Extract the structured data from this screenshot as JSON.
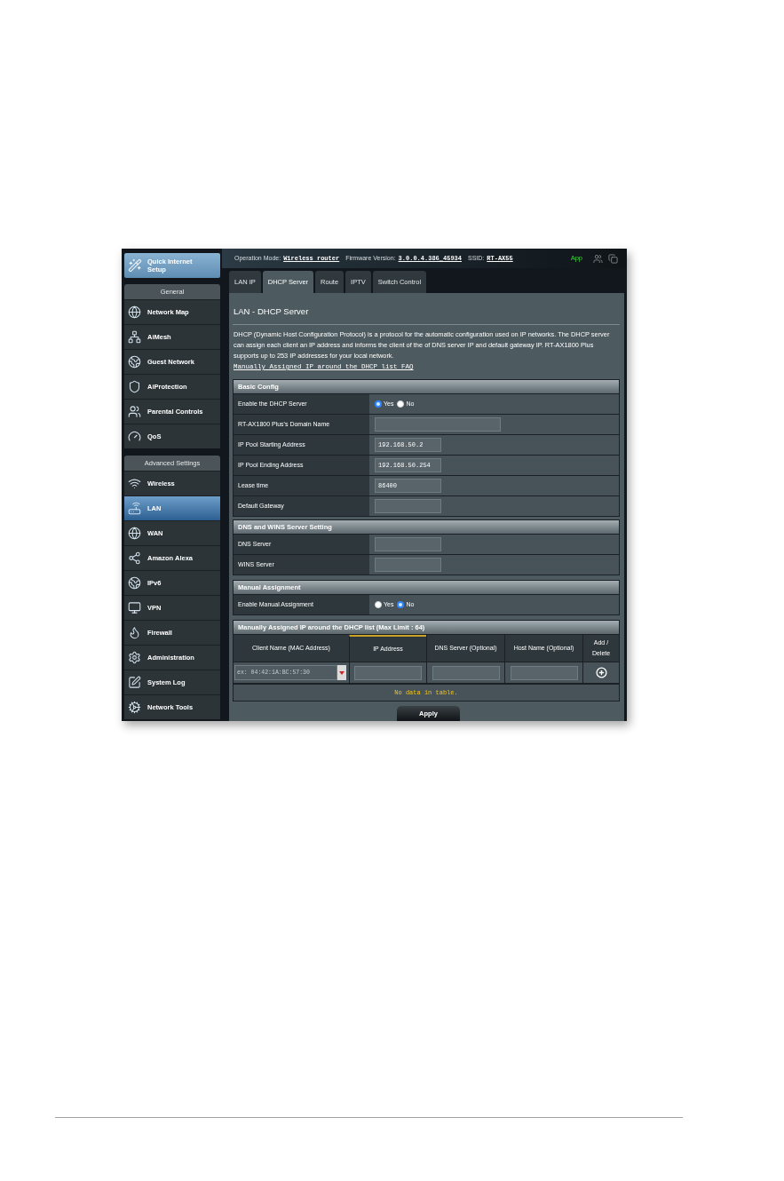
{
  "top_bar": {
    "items": [
      {
        "kind": "label",
        "text": "Operation Mode:"
      },
      {
        "kind": "link",
        "text": "Wireless router"
      },
      {
        "kind": "label",
        "text": "Firmware Version:"
      },
      {
        "kind": "link",
        "text": "3.0.0.4.386_45934"
      },
      {
        "kind": "label",
        "text": "SSID:"
      },
      {
        "kind": "link",
        "text": "RT-AX55"
      }
    ],
    "app": "App"
  },
  "sidebar": {
    "quick_setup": "Quick Internet Setup",
    "sections": [
      {
        "title": "General",
        "items": [
          {
            "label": "Network Map",
            "selected": false
          },
          {
            "label": "AiMesh",
            "selected": false
          },
          {
            "label": "Guest Network",
            "selected": false
          },
          {
            "label": "AiProtection",
            "selected": false
          },
          {
            "label": "Parental Controls",
            "selected": false
          },
          {
            "label": "QoS",
            "selected": false
          }
        ]
      },
      {
        "title": "Advanced Settings",
        "items": [
          {
            "label": "Wireless",
            "selected": false
          },
          {
            "label": "LAN",
            "selected": true
          },
          {
            "label": "WAN",
            "selected": false
          },
          {
            "label": "Amazon Alexa",
            "selected": false
          },
          {
            "label": "IPv6",
            "selected": false
          },
          {
            "label": "VPN",
            "selected": false
          },
          {
            "label": "Firewall",
            "selected": false
          },
          {
            "label": "Administration",
            "selected": false
          },
          {
            "label": "System Log",
            "selected": false
          },
          {
            "label": "Network Tools",
            "selected": false
          }
        ]
      }
    ]
  },
  "tabs": [
    {
      "label": "LAN IP",
      "selected": false
    },
    {
      "label": "DHCP Server",
      "selected": true
    },
    {
      "label": "Route",
      "selected": false
    },
    {
      "label": "IPTV",
      "selected": false
    },
    {
      "label": "Switch Control",
      "selected": false
    }
  ],
  "page": {
    "title": "LAN - DHCP Server",
    "description": "DHCP (Dynamic Host Configuration Protocol) is a protocol for the automatic configuration used on IP networks. The DHCP server can assign each client an IP address and informs the client of the of DNS server IP and default gateway IP. RT-AX1800 Plus supports up to 253 IP addresses for your local network.",
    "faq_link": "Manually Assigned IP around the DHCP list FAQ"
  },
  "sections": [
    {
      "title": "Basic Config",
      "rows": [
        {
          "kind": "radio",
          "label": "Enable the DHCP Server",
          "options": [
            {
              "label": "Yes",
              "selected": true
            },
            {
              "label": "No",
              "selected": false
            }
          ]
        },
        {
          "kind": "wide_input",
          "label": "RT-AX1800 Plus's Domain Name"
        },
        {
          "kind": "input",
          "label": "IP Pool Starting Address",
          "value": "192.168.50.2"
        },
        {
          "kind": "input",
          "label": "IP Pool Ending Address",
          "value": "192.168.50.254"
        },
        {
          "kind": "input",
          "label": "Lease time",
          "value": "86400"
        },
        {
          "kind": "input",
          "label": "Default Gateway"
        }
      ]
    },
    {
      "title": "DNS and WINS Server Setting",
      "rows": [
        {
          "kind": "input",
          "label": "DNS Server"
        },
        {
          "kind": "input",
          "label": "WINS Server"
        }
      ]
    },
    {
      "title": "Manual Assignment",
      "rows": [
        {
          "kind": "radio",
          "label": "Enable Manual Assignment",
          "options": [
            {
              "label": "Yes",
              "selected": false
            },
            {
              "label": "No",
              "selected": true
            }
          ]
        }
      ]
    }
  ],
  "dhcp_list": {
    "title": "Manually Assigned IP around the DHCP list (Max Limit : 64)",
    "columns": [
      {
        "label": "Client Name (MAC Address)",
        "highlighted": false
      },
      {
        "label": "IP Address",
        "highlighted": true
      },
      {
        "label": "DNS Server (Optional)",
        "highlighted": false
      },
      {
        "label": "Host Name (Optional)",
        "highlighted": false
      },
      {
        "label": "Add / Delete",
        "highlighted": false
      }
    ],
    "client_placeholder": "ex: 04:42:1A:BC:57:30",
    "empty_message": "No data in table."
  },
  "apply_button": "Apply"
}
